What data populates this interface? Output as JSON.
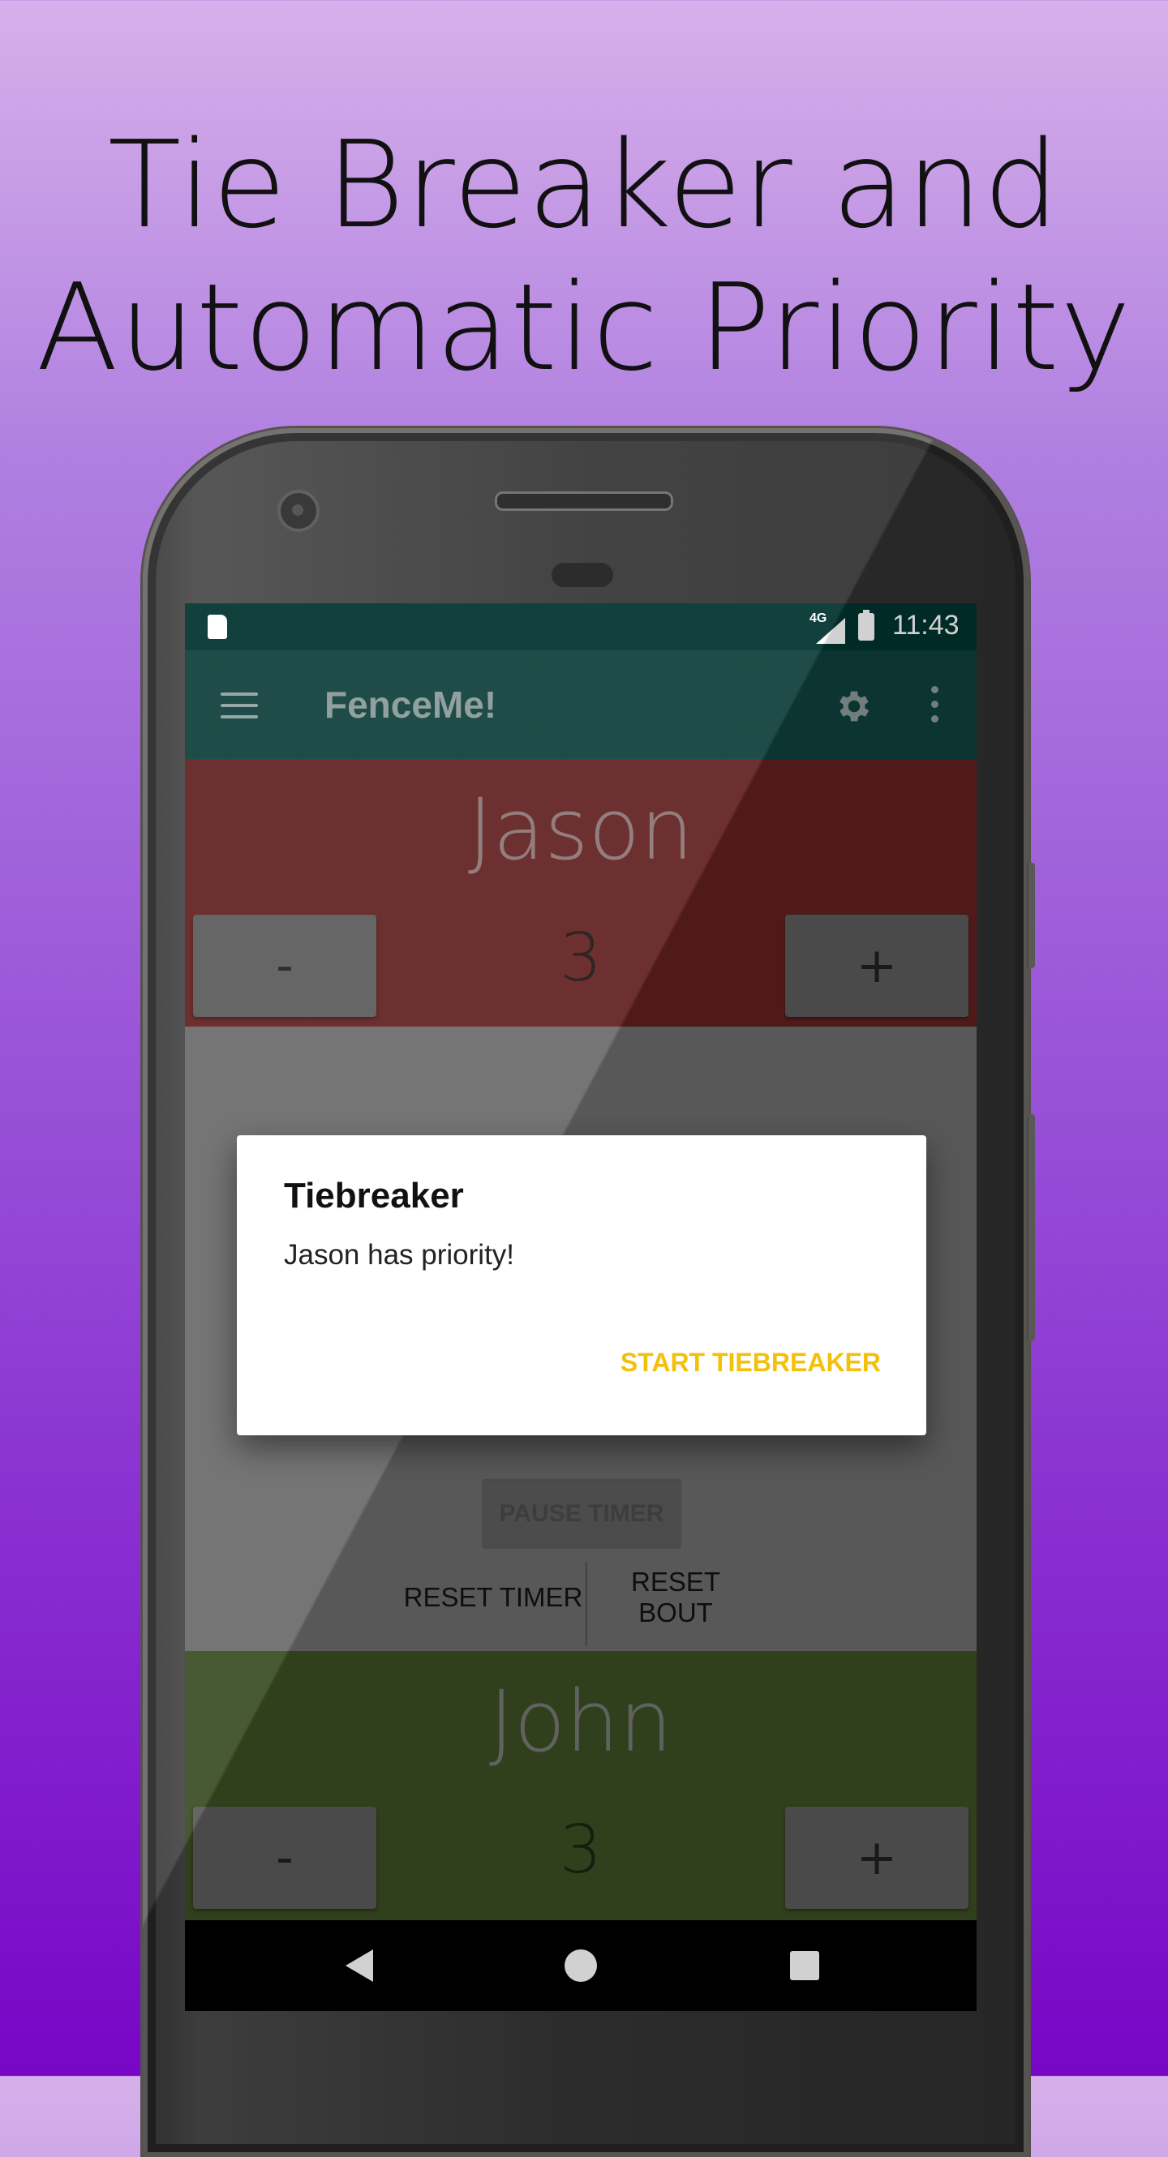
{
  "promo": {
    "line1": "Tie Breaker and",
    "line2": "Automatic Priority"
  },
  "status_bar": {
    "network": "4G",
    "time": "11:43"
  },
  "app_bar": {
    "title": "FenceMe!"
  },
  "top_fencer": {
    "name": "Jason",
    "score": "3",
    "minus_label": "-",
    "plus_label": "+",
    "color": "#612020"
  },
  "bottom_fencer": {
    "name": "John",
    "score": "3",
    "minus_label": "-",
    "plus_label": "+",
    "color": "#3a4d22"
  },
  "controls": {
    "pause_label": "PAUSE TIMER",
    "reset_timer_label": "RESET TIMER",
    "reset_bout_label": "RESET BOUT"
  },
  "dialog": {
    "title": "Tiebreaker",
    "message": "Jason has priority!",
    "action_label": "START TIEBREAKER",
    "action_color": "#f3c00c"
  },
  "icons": [
    "sd-card-icon",
    "signal-icon",
    "battery-icon",
    "menu-icon",
    "gear-icon",
    "more-vert-icon",
    "back-icon",
    "home-icon",
    "recents-icon"
  ]
}
